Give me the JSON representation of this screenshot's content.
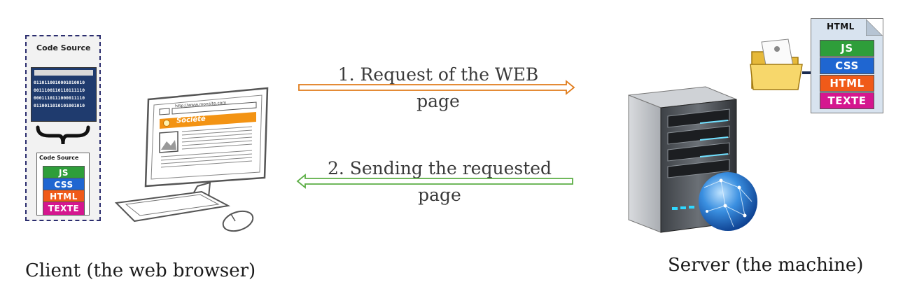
{
  "client": {
    "caption": "Client (the web browser)",
    "code_panel_title": "Code Source",
    "binary_lines": [
      "0110110010001010010",
      "0011100110110111110",
      "0001110111000011110",
      "0110011010101001010"
    ],
    "file_title": "Code Source",
    "badges": [
      {
        "label": "JS",
        "color": "#2e9e3a"
      },
      {
        "label": "CSS",
        "color": "#1f66d1"
      },
      {
        "label": "HTML",
        "color": "#f05a19"
      },
      {
        "label": "TEXTE",
        "color": "#d5178f"
      }
    ],
    "browser_url": "http://www.monsite.com",
    "site_banner": "Société"
  },
  "server": {
    "caption": "Server (the machine)",
    "file_title": "HTML",
    "badges": [
      {
        "label": "JS",
        "color": "#2e9e3a"
      },
      {
        "label": "CSS",
        "color": "#1f66d1"
      },
      {
        "label": "HTML",
        "color": "#f05a19"
      },
      {
        "label": "TEXTE",
        "color": "#d5178f"
      }
    ]
  },
  "arrows": {
    "request": {
      "line1": "1. Request of the WEB",
      "line2": "page",
      "color": "#e07b1a"
    },
    "response": {
      "line1": "2. Sending the requested",
      "line2": "page",
      "color": "#5cae45"
    }
  }
}
